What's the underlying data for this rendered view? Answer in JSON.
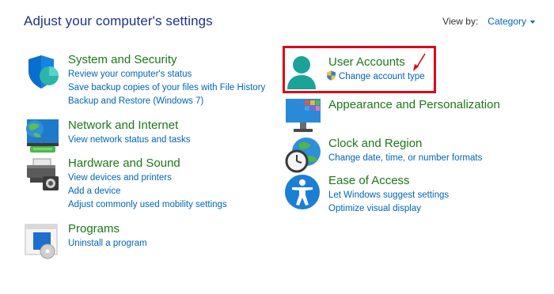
{
  "header": {
    "title": "Adjust your computer's settings",
    "view_by_label": "View by:",
    "view_by_value": "Category"
  },
  "categories": [
    {
      "title": "System and Security",
      "icon": "shield-icon",
      "links": [
        "Review your computer's status",
        "Save backup copies of your files with File History",
        "Backup and Restore (Windows 7)"
      ]
    },
    {
      "title": "Network and Internet",
      "icon": "globe-network-icon",
      "links": [
        "View network status and tasks"
      ]
    },
    {
      "title": "Hardware and Sound",
      "icon": "printer-icon",
      "links": [
        "View devices and printers",
        "Add a device",
        "Adjust commonly used mobility settings"
      ]
    },
    {
      "title": "Programs",
      "icon": "programs-icon",
      "links": [
        "Uninstall a program"
      ]
    },
    {
      "title": "User Accounts",
      "icon": "user-icon",
      "links": [
        "Change account type"
      ]
    },
    {
      "title": "Appearance and Personalization",
      "icon": "monitor-icon",
      "links": []
    },
    {
      "title": "Clock and Region",
      "icon": "clock-globe-icon",
      "links": [
        "Change date, time, or number formats"
      ]
    },
    {
      "title": "Ease of Access",
      "icon": "accessibility-icon",
      "links": [
        "Let Windows suggest settings",
        "Optimize visual display"
      ]
    }
  ],
  "colors": {
    "title_blue": "#1e3287",
    "link_blue": "#0066b4",
    "category_green": "#1c7818",
    "highlight_red": "#d80c17"
  }
}
